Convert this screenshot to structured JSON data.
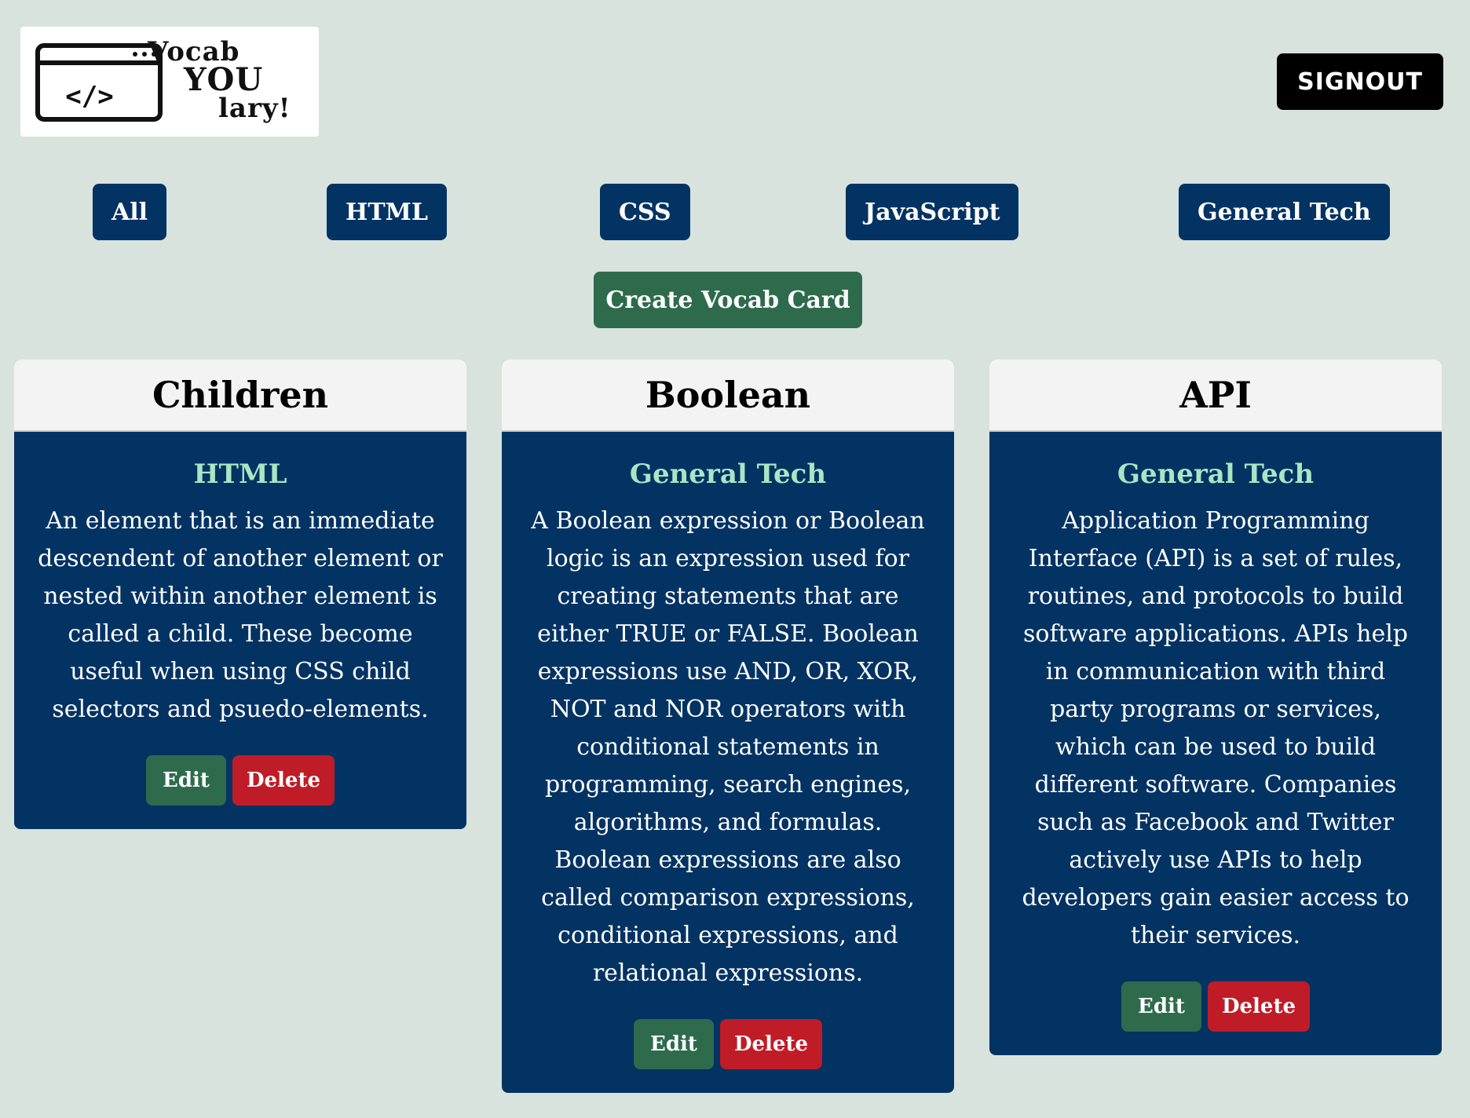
{
  "logo": {
    "words": [
      "Vocab",
      "YOU",
      "lary!"
    ],
    "code_symbol": "</>"
  },
  "header": {
    "signout_label": "SIGNOUT"
  },
  "filters": [
    {
      "label": "All"
    },
    {
      "label": "HTML"
    },
    {
      "label": "CSS"
    },
    {
      "label": "JavaScript"
    },
    {
      "label": "General Tech"
    }
  ],
  "create_label": "Create Vocab Card",
  "cards": [
    {
      "title": "Children",
      "category": "HTML",
      "description": "An element that is an immediate descendent of another element or nested within another element is called a child. These become useful when using CSS child selectors and psuedo-elements.",
      "edit_label": "Edit",
      "delete_label": "Delete"
    },
    {
      "title": "Boolean",
      "category": "General Tech",
      "description": "A Boolean expression or Boolean logic is an expression used for creating statements that are either TRUE or FALSE. Boolean expressions use AND, OR, XOR, NOT and NOR operators with conditional statements in programming, search engines, algorithms, and formulas. Boolean expressions are also called comparison expressions, conditional expressions, and relational expressions.",
      "edit_label": "Edit",
      "delete_label": "Delete"
    },
    {
      "title": "API",
      "category": "General Tech",
      "description": "Application Programming Interface (API) is a set of rules, routines, and protocols to build software applications. APIs help in communication with third party programs or services, which can be used to build different software. Companies such as Facebook and Twitter actively use APIs to help developers gain easier access to their services.",
      "edit_label": "Edit",
      "delete_label": "Delete"
    }
  ],
  "colors": {
    "page_background": "#d8e3de",
    "navy": "#033363",
    "green": "#2e6b4c",
    "red": "#c01c28",
    "category_text": "#a8e6c4"
  }
}
